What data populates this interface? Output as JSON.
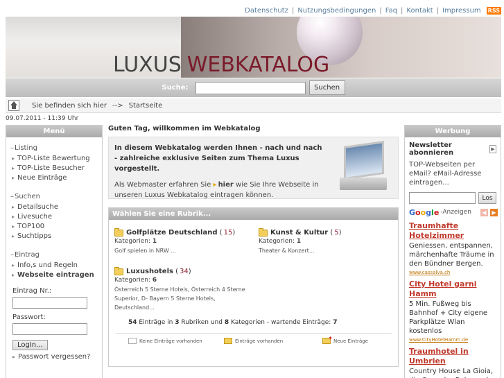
{
  "toplinks": [
    "Datenschutz",
    "Nutzungsbedingungen",
    "Faq",
    "Kontakt",
    "Impressum"
  ],
  "rss": "RSS",
  "banner": {
    "logo_part1": "LUXUS",
    "logo_part2": "WEBKATALOG"
  },
  "search": {
    "label": "Suche:",
    "value": "",
    "button": "Suchen"
  },
  "breadcrumb": {
    "prefix": "Sie befinden sich hier",
    "arrow": "-->",
    "current": "Startseite"
  },
  "datetime": "09.07.2011 - 11:39 Uhr",
  "left_menu": {
    "header": "Menü",
    "sections": [
      {
        "title": "Listing",
        "items": [
          "TOP-Liste Bewertung",
          "TOP-Liste Besucher",
          "Neue Einträge"
        ]
      },
      {
        "title": "Suchen",
        "items": [
          "Detailsuche",
          "Livesuche",
          "TOP100",
          "Suchtipps"
        ]
      },
      {
        "title": "Eintrag",
        "items": [
          "Info,s und Regeln",
          "Webseite eintragen"
        ]
      }
    ],
    "login": {
      "entry_label": "Eintrag Nr.:",
      "password_label": "Passwort:",
      "button": "LogIn...",
      "forgot": "Passwort vergessen?"
    }
  },
  "main": {
    "greeting": "Guten Tag, willkommen im Webkatalog",
    "intro_bold": "In diesem Webkatalog werden Ihnen - nach und nach - zahlreiche exklusive Seiten zum Thema Luxus vorgestellt.",
    "intro_text_1": "Als Webmaster erfahren Sie",
    "intro_link": "hier",
    "intro_text_2": "wie Sie Ihre Webseite in unseren Luxus Webkatalog eintragen können.",
    "rubrik_header": "Wählen Sie eine Rubrik...",
    "kategorien_label": "Kategorien:",
    "categories": [
      {
        "name": "Golfplätze Deutschland",
        "count": "15",
        "kategorien": "1",
        "desc": "Golf spielen in NRW ..."
      },
      {
        "name": "Kunst & Kultur",
        "count": "5",
        "kategorien": "1",
        "desc": "Theater & Konzert..."
      },
      {
        "name": "Luxushotels",
        "count": "34",
        "kategorien": "6",
        "desc": "Österreich 5 Sterne Hotels, Österreich 4 Sterne Superior, D- Bayern 5 Sterne Hotels, Deutschland..."
      }
    ],
    "summary": {
      "entries": "54",
      "t1": "Einträge in",
      "rubriken": "3",
      "t2": "Rubriken und",
      "kategorien": "8",
      "t3": "Kategorien - wartende Einträge:",
      "waiting": "7"
    },
    "legend": [
      "Keine Einträge vorhanden",
      "Einträge vorhanden",
      "Neue Einträge"
    ]
  },
  "right": {
    "header": "Werbung",
    "newsletter_title": "Newsletter abonnieren",
    "newsletter_text": "TOP-Webseiten per eMail? eMail-Adresse eintragen...",
    "newsletter_button": "Los",
    "google_label": "-Anzeigen",
    "ads": [
      {
        "title": "Traumhafte Hotelzimmer",
        "desc": "Geniessen, entspannen, märchenhafte Träume in den Bündner Bergen.",
        "url": "www.cassalva.ch"
      },
      {
        "title": "City Hotel garni Hamm",
        "desc": "5 Min. Fußweg bis Bahnhof + City eigene Parkplätze Wlan kostenlos",
        "url": "www.CityHotelHamm.de"
      },
      {
        "title": "Traumhotel in Umbrien",
        "desc": "Country House La Gioia, die Oase der Ruhe und",
        "url": ""
      }
    ]
  }
}
